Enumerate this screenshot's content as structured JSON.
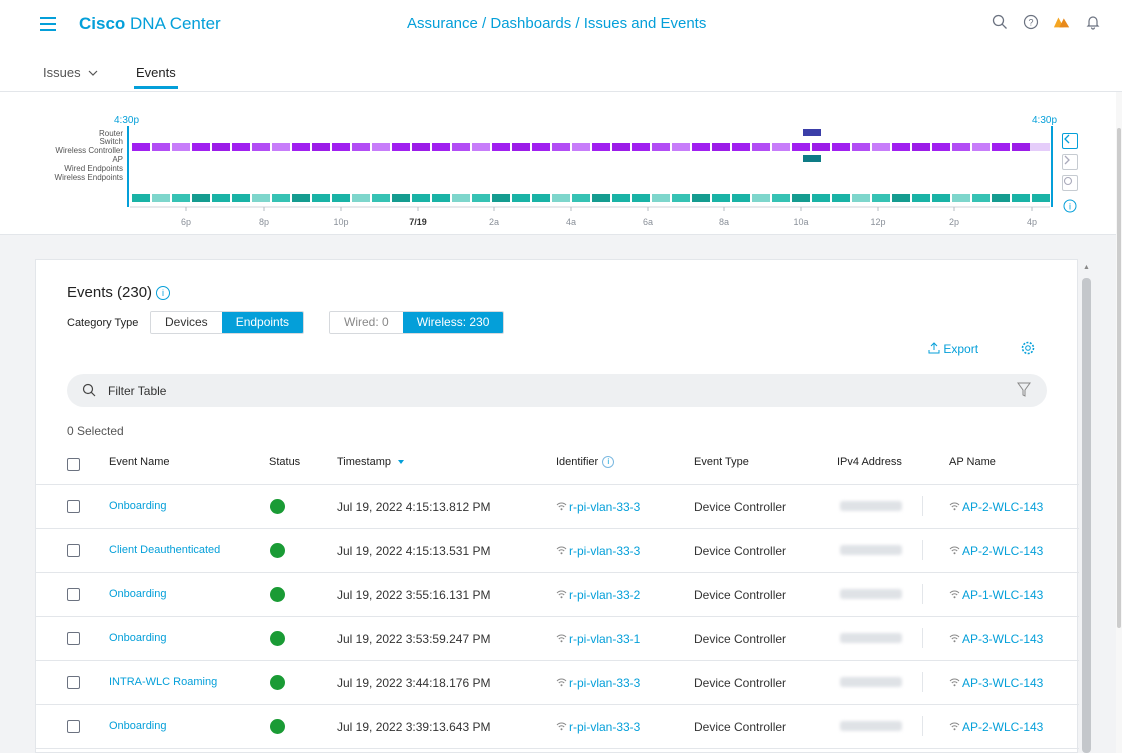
{
  "header": {
    "brand_bold": "Cisco",
    "brand_rest": " DNA Center",
    "breadcrumb": "Assurance / Dashboards / Issues and Events",
    "icons": [
      "menu-icon",
      "search-icon",
      "help-icon",
      "alert-icon",
      "bell-icon"
    ],
    "alert_color": "#f5a623"
  },
  "tabs": {
    "issues": "Issues",
    "events": "Events"
  },
  "timeline": {
    "start_label": "4:30p",
    "end_label": "4:30p",
    "rows": [
      "Router",
      "Switch",
      "Wireless Controller",
      "AP",
      "Wired Endpoints",
      "Wireless Endpoints"
    ],
    "ticks": [
      "6p",
      "8p",
      "10p",
      "7/19",
      "2a",
      "4a",
      "6a",
      "8a",
      "10a",
      "12p",
      "2p",
      "4p"
    ],
    "switch_color": "#a020f0",
    "endpoint_color": "#1ab3a6"
  },
  "events": {
    "title": "Events (230)",
    "category_label": "Category Type",
    "category_options": [
      "Devices",
      "Endpoints"
    ],
    "category_selected": "Endpoints",
    "type_options": [
      "Wired: 0",
      "Wireless: 230"
    ],
    "type_selected": "Wireless: 230",
    "export_label": "Export",
    "filter_placeholder": "Filter Table",
    "selected_text": "0 Selected",
    "columns": {
      "event_name": "Event Name",
      "status": "Status",
      "timestamp": "Timestamp",
      "identifier": "Identifier",
      "event_type": "Event Type",
      "ipv4": "IPv4 Address",
      "ap_name": "AP Name"
    },
    "status_color": "#1a9b35",
    "rows": [
      {
        "event": "Onboarding",
        "timestamp": "Jul 19, 2022 4:15:13.812 PM",
        "identifier": "r-pi-vlan-33-3",
        "type": "Device Controller",
        "ap": "AP-2-WLC-143"
      },
      {
        "event": "Client Deauthenticated",
        "timestamp": "Jul 19, 2022 4:15:13.531 PM",
        "identifier": "r-pi-vlan-33-3",
        "type": "Device Controller",
        "ap": "AP-2-WLC-143"
      },
      {
        "event": "Onboarding",
        "timestamp": "Jul 19, 2022 3:55:16.131 PM",
        "identifier": "r-pi-vlan-33-2",
        "type": "Device Controller",
        "ap": "AP-1-WLC-143"
      },
      {
        "event": "Onboarding",
        "timestamp": "Jul 19, 2022 3:53:59.247 PM",
        "identifier": "r-pi-vlan-33-1",
        "type": "Device Controller",
        "ap": "AP-3-WLC-143"
      },
      {
        "event": "INTRA-WLC Roaming",
        "timestamp": "Jul 19, 2022 3:44:18.176 PM",
        "identifier": "r-pi-vlan-33-3",
        "type": "Device Controller",
        "ap": "AP-3-WLC-143"
      },
      {
        "event": "Onboarding",
        "timestamp": "Jul 19, 2022 3:39:13.643 PM",
        "identifier": "r-pi-vlan-33-3",
        "type": "Device Controller",
        "ap": "AP-2-WLC-143"
      }
    ]
  }
}
